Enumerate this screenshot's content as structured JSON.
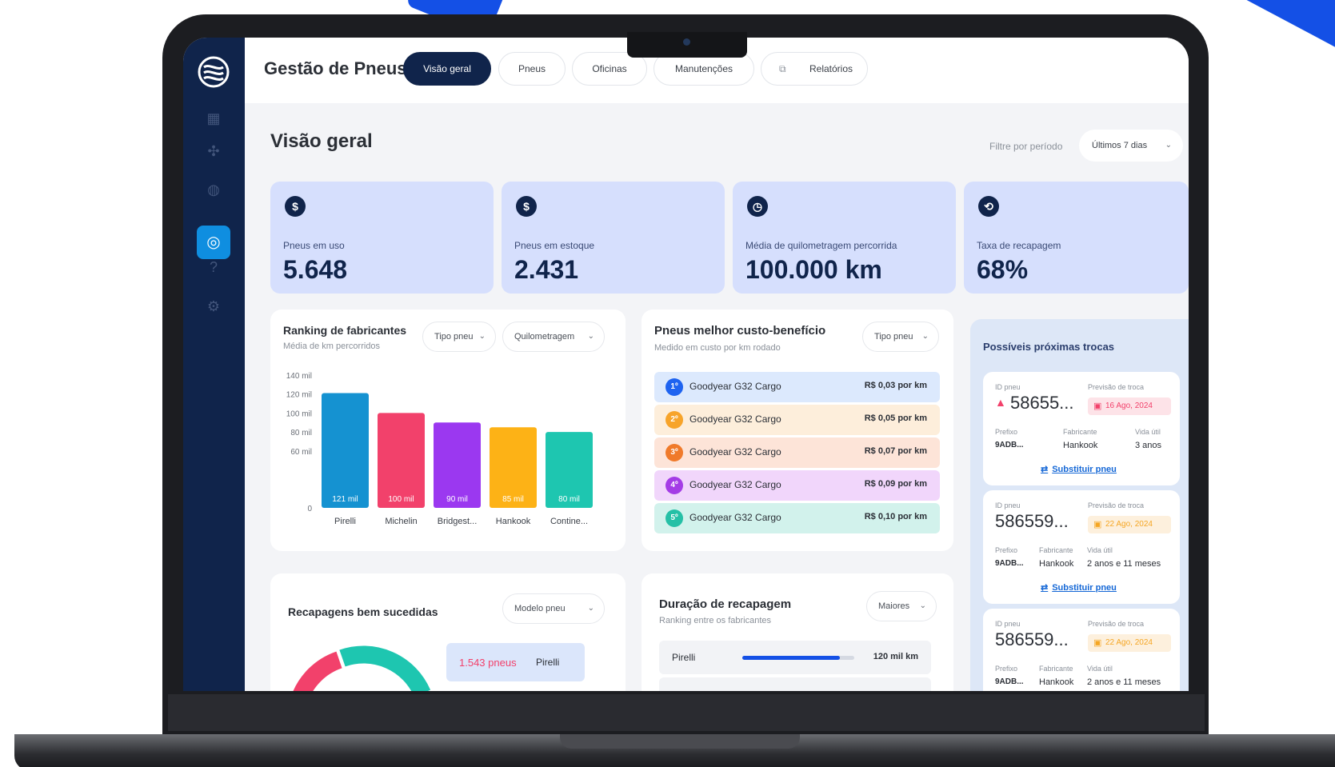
{
  "app": {
    "title": "Gestão de Pneus"
  },
  "tabs": [
    {
      "label": "Visão geral",
      "active": true
    },
    {
      "label": "Pneus",
      "active": false
    },
    {
      "label": "Oficinas",
      "active": false
    },
    {
      "label": "Manutenções",
      "active": false
    },
    {
      "label": "Relatórios",
      "active": false,
      "icon": "external-link-icon"
    }
  ],
  "sidebar": {
    "icons": [
      "dashboard-icon",
      "tools-icon",
      "globe-icon",
      "tire-icon",
      "help-icon",
      "settings-icon"
    ],
    "active_index": 3
  },
  "page": {
    "title": "Visão geral",
    "filter_label": "Filtre por período",
    "filter_value": "Últimos 7 dias"
  },
  "kpis": [
    {
      "label": "Pneus em uso",
      "value": "5.648"
    },
    {
      "label": "Pneus em estoque",
      "value": "2.431"
    },
    {
      "label": "Média de quilometragem percorrida",
      "value": "100.000 km"
    },
    {
      "label": "Taxa de recapagem",
      "value": "68%"
    }
  ],
  "ranking": {
    "title": "Ranking de fabricantes",
    "subtitle": "Média de km percorridos",
    "filter_type": "Tipo pneu",
    "filter_metric": "Quilometragem"
  },
  "chart_data": {
    "type": "bar",
    "title": "Ranking de fabricantes",
    "subtitle": "Média de km percorridos",
    "categories": [
      "Pirelli",
      "Michelin",
      "Bridgest...",
      "Hankook",
      "Contine..."
    ],
    "values": [
      121,
      100,
      90,
      85,
      80
    ],
    "value_labels": [
      "121 mil",
      "100 mil",
      "90 mil",
      "85 mil",
      "80 mil"
    ],
    "colors": [
      "#1592d1",
      "#f2416b",
      "#9b38f0",
      "#fdb216",
      "#1ec6b0"
    ],
    "ytick_labels": [
      "140 mil",
      "120 mil",
      "100 mil",
      "80 mil",
      "60 mil",
      "0"
    ],
    "ylim": [
      0,
      140
    ],
    "grid": false
  },
  "cost_benefit": {
    "title": "Pneus melhor custo-benefício",
    "subtitle": "Medido em custo por km rodado",
    "filter": "Tipo pneu",
    "rows": [
      {
        "rank": "1º",
        "name": "Goodyear G32 Cargo",
        "cost": "R$ 0,03 por km",
        "bg": "#dce9fd",
        "badge": "#1e63f0"
      },
      {
        "rank": "2º",
        "name": "Goodyear G32 Cargo",
        "cost": "R$ 0,05 por km",
        "bg": "#fdeedb",
        "badge": "#f7a42a"
      },
      {
        "rank": "3º",
        "name": "Goodyear G32 Cargo",
        "cost": "R$ 0,07 por km",
        "bg": "#fde4d8",
        "badge": "#f07a2a"
      },
      {
        "rank": "4º",
        "name": "Goodyear G32 Cargo",
        "cost": "R$ 0,09 por km",
        "bg": "#f1d6fb",
        "badge": "#a43ce6"
      },
      {
        "rank": "5º",
        "name": "Goodyear G32 Cargo",
        "cost": "R$ 0,10 por km",
        "bg": "#d2f2ec",
        "badge": "#25c0a6"
      }
    ]
  },
  "recap_success": {
    "title": "Recapagens bem sucedidas",
    "filter": "Modelo pneu",
    "legend_value": "1.543 pneus",
    "legend_name": "Pirelli"
  },
  "recap_duration": {
    "title": "Duração de recapagem",
    "subtitle": "Ranking entre os fabricantes",
    "filter": "Maiores",
    "rows": [
      {
        "name": "Pirelli",
        "value": "120 mil km",
        "fraction": 0.87
      }
    ]
  },
  "next_changes": {
    "title": "Possíveis próximas trocas",
    "labels": {
      "id": "ID pneu",
      "period": "Previsão de troca",
      "prefix": "Prefixo",
      "maker": "Fabricante",
      "life": "Vida útil"
    },
    "link_label": "Substituir pneu",
    "cards": [
      {
        "id": "58655...",
        "alert": true,
        "date": "16 Ago, 2024",
        "date_color": "#f2416b",
        "date_bg": "#fde3e8",
        "prefix": "9ADB...",
        "maker": "Hankook",
        "life": "3 anos"
      },
      {
        "id": "586559...",
        "alert": false,
        "date": "22 Ago, 2024",
        "date_color": "#f5a623",
        "date_bg": "#fdf0dd",
        "prefix": "9ADB...",
        "maker": "Hankook",
        "life": "2 anos e 11 meses"
      },
      {
        "id": "586559...",
        "alert": false,
        "date": "22 Ago, 2024",
        "date_color": "#f5a623",
        "date_bg": "#fdf0dd",
        "prefix": "9ADB...",
        "maker": "Hankook",
        "life": "2 anos e 11 meses"
      }
    ]
  }
}
